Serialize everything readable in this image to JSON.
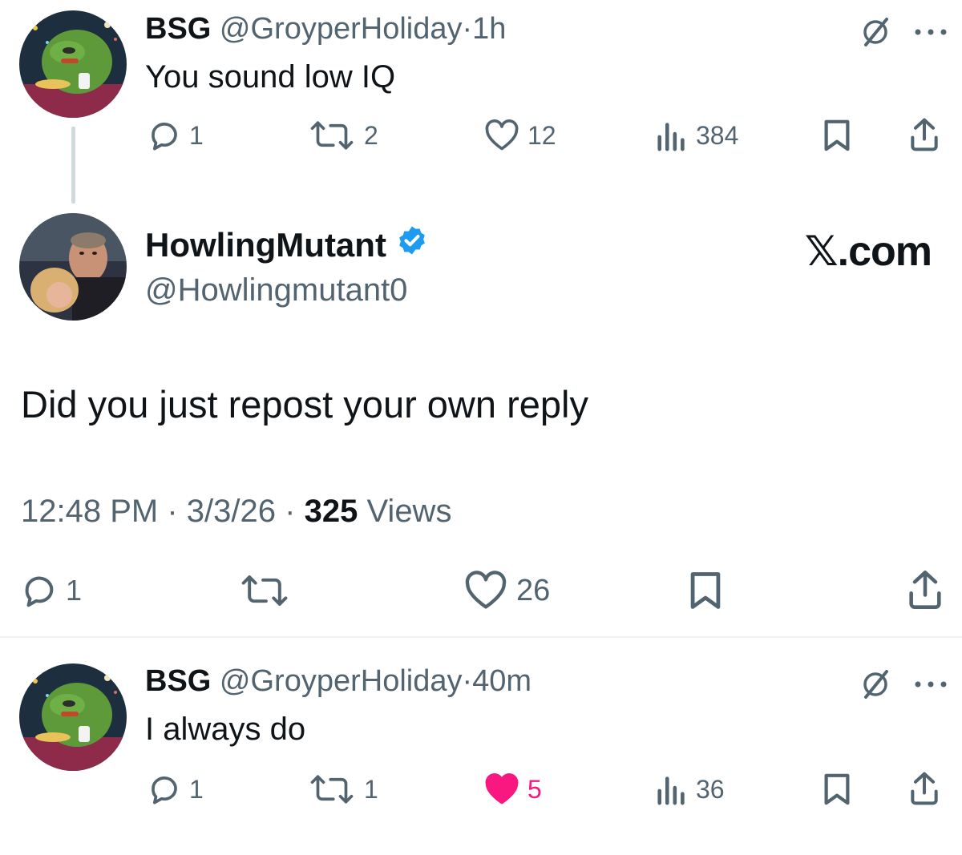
{
  "tweet1": {
    "name": "BSG",
    "handle": "@GroyperHoliday",
    "separator": "·",
    "time": "1h",
    "text": "You sound low IQ",
    "replies": "1",
    "reposts": "2",
    "likes": "12",
    "views": "384"
  },
  "main": {
    "name": "HowlingMutant",
    "handle": "@Howlingmutant0",
    "brand": "𝕏.com",
    "text": "Did you just repost your own reply",
    "time": "12:48 PM",
    "sep1": "·",
    "date": "3/3/26",
    "sep2": "·",
    "views_count": "325",
    "views_label": "Views",
    "replies": "1",
    "likes": "26",
    "verified_color": "#1d9bf0"
  },
  "tweet2": {
    "name": "BSG",
    "handle": "@GroyperHoliday",
    "separator": "·",
    "time": "40m",
    "text": "I always do",
    "replies": "1",
    "reposts": "1",
    "likes": "5",
    "likes_color": "#f91880",
    "views": "36"
  },
  "icons": {
    "reply": "reply-icon",
    "repost": "repost-icon",
    "like": "heart-icon",
    "views": "views-icon",
    "bookmark": "bookmark-icon",
    "share": "share-icon",
    "grok": "grok-icon",
    "more": "more-icon",
    "verified": "verified-badge-icon"
  }
}
